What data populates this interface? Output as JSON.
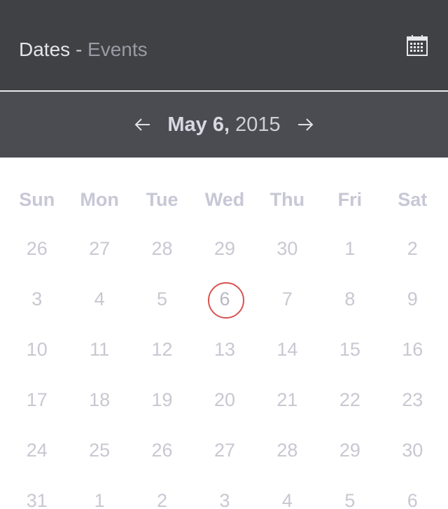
{
  "header": {
    "title": "Dates",
    "separator": "-",
    "subtitle": "Events",
    "calendar_icon": "calendar-icon"
  },
  "datebar": {
    "prev_icon": "arrow-left-icon",
    "next_icon": "arrow-right-icon",
    "month_day": "May 6,",
    "year": "2015"
  },
  "calendar": {
    "weekdays": [
      "Sun",
      "Mon",
      "Tue",
      "Wed",
      "Thu",
      "Fri",
      "Sat"
    ],
    "days": [
      "26",
      "27",
      "28",
      "29",
      "30",
      "1",
      "2",
      "3",
      "4",
      "5",
      "6",
      "7",
      "8",
      "9",
      "10",
      "11",
      "12",
      "13",
      "14",
      "15",
      "16",
      "17",
      "18",
      "19",
      "20",
      "21",
      "22",
      "23",
      "24",
      "25",
      "26",
      "27",
      "28",
      "29",
      "30",
      "31",
      "1",
      "2",
      "3",
      "4",
      "5",
      "6"
    ],
    "selected_index": 10
  },
  "colors": {
    "header_bg": "#404145",
    "datebar_bg": "#4b4c51",
    "selected_ring": "#d9534f",
    "day_text": "#c8c8d2"
  }
}
